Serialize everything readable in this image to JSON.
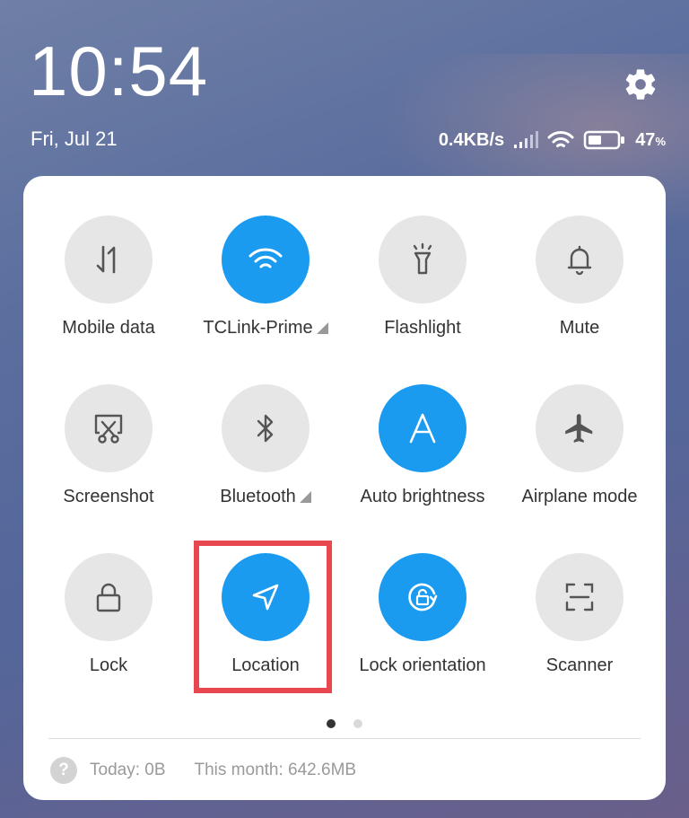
{
  "status_bar": {
    "time": "10:54",
    "date": "Fri, Jul 21",
    "network_speed": "0.4KB/s",
    "battery_percent": "47",
    "battery_unit": "%",
    "battery_level": 0.47,
    "icons": [
      "signal-icon",
      "wifi-icon",
      "battery-icon",
      "gear-icon"
    ]
  },
  "tiles": [
    {
      "label": "Mobile data",
      "icon": "mobile-data-icon",
      "active": false
    },
    {
      "label": "TCLink-Prime",
      "icon": "wifi-icon",
      "active": true,
      "expandable": true
    },
    {
      "label": "Flashlight",
      "icon": "flashlight-icon",
      "active": false
    },
    {
      "label": "Mute",
      "icon": "bell-icon",
      "active": false
    },
    {
      "label": "Screenshot",
      "icon": "screenshot-icon",
      "active": false
    },
    {
      "label": "Bluetooth",
      "icon": "bluetooth-icon",
      "active": false,
      "expandable": true
    },
    {
      "label": "Auto brightness",
      "icon": "auto-brightness-icon",
      "active": true
    },
    {
      "label": "Airplane mode",
      "icon": "airplane-icon",
      "active": false
    },
    {
      "label": "Lock",
      "icon": "lock-icon",
      "active": false
    },
    {
      "label": "Location",
      "icon": "location-arrow-icon",
      "active": true,
      "highlighted": true
    },
    {
      "label": "Lock orientation",
      "icon": "rotation-lock-icon",
      "active": true
    },
    {
      "label": "Scanner",
      "icon": "scanner-icon",
      "active": false
    }
  ],
  "pagination": {
    "pages": 2,
    "current": 1
  },
  "usage": {
    "today": "Today: 0B",
    "month": "This month: 642.6MB",
    "help_glyph": "?"
  },
  "colors": {
    "accent": "#1a9bf0",
    "inactive": "#e6e6e6",
    "highlight_box": "#e8474f"
  }
}
